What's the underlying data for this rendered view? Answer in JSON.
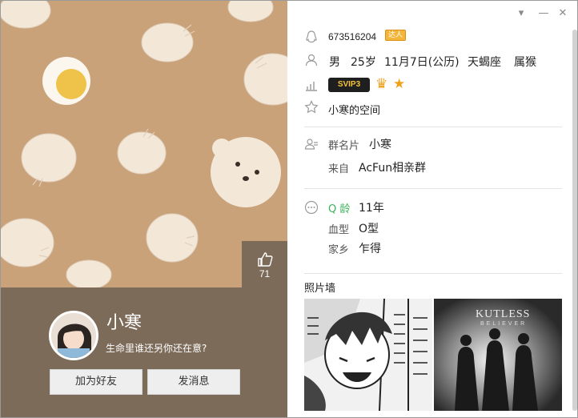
{
  "like": {
    "count": "71"
  },
  "profile": {
    "nickname": "小寒",
    "signature": "生命里谁还另你还在意?",
    "add_friend_label": "加为好友",
    "send_message_label": "发消息"
  },
  "window": {
    "min_symbol": "—",
    "close_symbol": "✕",
    "menu_symbol": "▾"
  },
  "info": {
    "qq_number": "673516204",
    "daren_badge": "达人",
    "gender": "男",
    "age": "25岁",
    "birthday": "11月7日(公历)",
    "zodiac": "天蝎座",
    "chinese_zodiac": "属猴",
    "svip_badge": "SVIP3",
    "space_name": "小寒的空间",
    "group_card_label": "群名片",
    "group_card_value": "小寒",
    "from_label": "来自",
    "from_value": "AcFun相亲群",
    "q_age_label": "Q 龄",
    "q_age_value": "11年",
    "blood_label": "血型",
    "blood_value": "O型",
    "hometown_label": "家乡",
    "hometown_value": "乍得"
  },
  "photo_wall": {
    "title": "照片墙",
    "photo2_title": "KUTLESS",
    "photo2_subtitle": "BELIEVER"
  },
  "colors": {
    "background_brown": "#c9a27a",
    "panel_brown": "#7d6b5a",
    "bun_cream": "#f3e7d8",
    "yolk": "#efc34a",
    "q_green": "#3bb15a"
  }
}
